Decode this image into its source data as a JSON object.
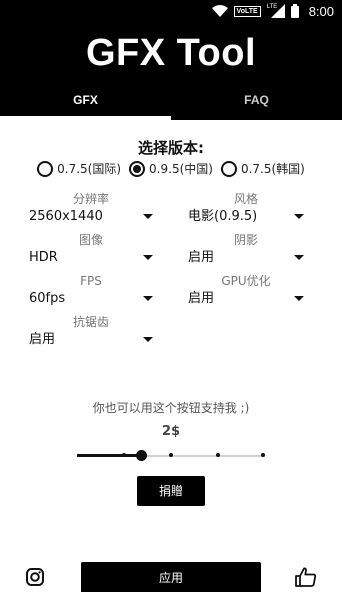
{
  "status_bar": {
    "time": "8:00",
    "network_label": "VoLTE",
    "lte_label": "LTE"
  },
  "app": {
    "title": "GFX Tool"
  },
  "tabs": [
    {
      "label": "GFX",
      "active": true
    },
    {
      "label": "FAQ",
      "active": false
    }
  ],
  "version": {
    "title": "选择版本:",
    "options": [
      {
        "label": "0.7.5(国际)",
        "checked": false
      },
      {
        "label": "0.9.5(中国)",
        "checked": true
      },
      {
        "label": "0.7.5(韩国)",
        "checked": false
      }
    ]
  },
  "settings": {
    "resolution": {
      "label": "分辨率",
      "value": "2560x1440"
    },
    "style": {
      "label": "风格",
      "value": "电影(0.9.5)"
    },
    "graphics": {
      "label": "图像",
      "value": "HDR"
    },
    "shadow": {
      "label": "阴影",
      "value": "启用"
    },
    "fps": {
      "label": "FPS",
      "value": "60fps"
    },
    "gpu": {
      "label": "GPU优化",
      "value": "启用"
    },
    "antialias": {
      "label": "抗锯齿",
      "value": "启用"
    }
  },
  "support": {
    "text": "你也可以用这个按钮支持我 ;)",
    "amount": "2$",
    "slider_value_fraction": 0.34,
    "slider_steps": 4,
    "donate_label": "捐贈"
  },
  "bottom": {
    "apply_label": "应用"
  },
  "colors": {
    "primary": "#000000",
    "background": "#ffffff",
    "label_gray": "#777777"
  },
  "icons": [
    "wifi-icon",
    "signal-icon",
    "battery-icon",
    "instagram-icon",
    "thumbs-up-icon",
    "radio-icon",
    "dropdown-caret-icon"
  ]
}
